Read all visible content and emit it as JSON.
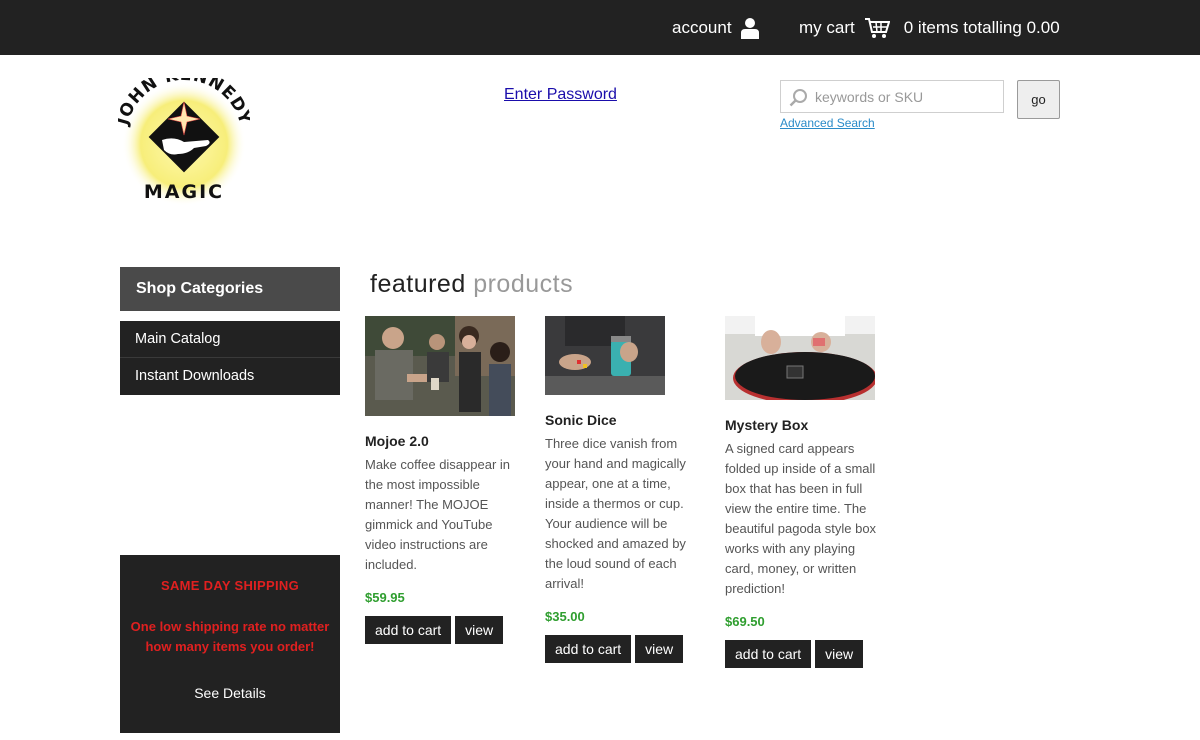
{
  "topbar": {
    "account_label": "account",
    "account_icon": "user-icon",
    "cart_label": "my cart",
    "cart_icon": "cart-icon",
    "cart_summary": "0 items totalling 0.00"
  },
  "header": {
    "logo_text_top": "JOHN KENNEDY",
    "logo_text_bottom": "MAGIC",
    "enter_password": "Enter Password",
    "search_placeholder": "keywords or SKU",
    "search_value": "",
    "go_label": "go",
    "advanced_search": "Advanced Search"
  },
  "sidebar": {
    "heading": "Shop Categories",
    "items": [
      {
        "label": "Main Catalog"
      },
      {
        "label": "Instant Downloads"
      }
    ],
    "shipping": {
      "title": "SAME DAY SHIPPING",
      "text": "One low shipping rate no matter how many items you order!",
      "details": "See Details"
    }
  },
  "featured": {
    "word1": "featured",
    "word2": "products",
    "products": [
      {
        "name": "Mojoe 2.0",
        "description": "Make coffee disappear in the most impossible manner! The MOJOE gimmick and YouTube video instructions are included.",
        "price": "$59.95",
        "add_label": "add to cart",
        "view_label": "view"
      },
      {
        "name": "Sonic Dice",
        "description": "Three dice vanish from your hand and magically appear, one at a time, inside a thermos or cup. Your audience will be shocked and amazed by the loud sound of each arrival!",
        "price": "$35.00",
        "add_label": "add to cart",
        "view_label": "view"
      },
      {
        "name": "Mystery Box",
        "description": "A signed card appears folded up inside of a small box that has been in full view the entire time. The beautiful pagoda style box works with any playing card, money, or written prediction!",
        "price": "$69.50",
        "add_label": "add to cart",
        "view_label": "view"
      }
    ]
  },
  "colors": {
    "topbar_bg": "#222222",
    "price_green": "#2f9e2f",
    "shipping_red": "#e02020",
    "link_blue": "#1a0dab"
  }
}
